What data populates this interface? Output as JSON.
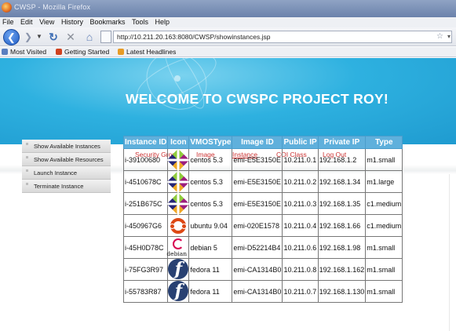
{
  "window": {
    "title": "CWSP - Mozilla Firefox"
  },
  "menu": [
    "File",
    "Edit",
    "View",
    "History",
    "Bookmarks",
    "Tools",
    "Help"
  ],
  "url": "http://10.211.20.163:8080/CWSP/showinstances.jsp",
  "bookmarks": [
    {
      "label": "Most Visited",
      "color": "#5a7fc0"
    },
    {
      "label": "Getting Started",
      "color": "#d0421f"
    },
    {
      "label": "Latest Headlines",
      "color": "#e79b26"
    }
  ],
  "banner": {
    "title": "WELCOME TO CWSPC PROJECT ROY!"
  },
  "nav": [
    {
      "label": "Security Group",
      "active": false
    },
    {
      "label": "Image",
      "active": false
    },
    {
      "label": "Instance",
      "active": true
    },
    {
      "label": "COI Class",
      "active": false
    },
    {
      "label": "Log Out",
      "active": false
    }
  ],
  "sidebar": [
    "Show Available Instances",
    "Show Available Resources",
    "Launch Instance",
    "Terminate Instance"
  ],
  "table": {
    "headers": [
      "Instance ID",
      "Icon",
      "VMOSType",
      "Image ID",
      "Public IP",
      "Private IP",
      "Type"
    ],
    "rows": [
      {
        "id": "i-39100680",
        "icon": "centos-icon",
        "os": "centos 5.3",
        "image": "emi-E5E3150E",
        "public_ip": "10.211.0.1",
        "private_ip": "192.168.1.2",
        "type": "m1.small"
      },
      {
        "id": "i-4510678C",
        "icon": "centos-icon",
        "os": "centos 5.3",
        "image": "emi-E5E3150E",
        "public_ip": "10.211.0.2",
        "private_ip": "192.168.1.34",
        "type": "m1.large"
      },
      {
        "id": "i-251B675C",
        "icon": "centos-icon",
        "os": "centos 5.3",
        "image": "emi-E5E3150E",
        "public_ip": "10.211.0.3",
        "private_ip": "192.168.1.35",
        "type": "c1.medium"
      },
      {
        "id": "i-450967G6",
        "icon": "ubuntu-icon",
        "os": "ubuntu 9.04",
        "image": "emi-020E1578",
        "public_ip": "10.211.0.4",
        "private_ip": "192.168.1.66",
        "type": "c1.medium"
      },
      {
        "id": "i-45H0D78C",
        "icon": "debian-icon",
        "os": "debian 5",
        "image": "emi-D52214B4",
        "public_ip": "10.211.0.6",
        "private_ip": "192.168.1.98",
        "type": "m1.small"
      },
      {
        "id": "i-75FG3R97",
        "icon": "fedora-icon",
        "os": "fedora 11",
        "image": "emi-CA1314B0",
        "public_ip": "10.211.0.8",
        "private_ip": "192.168.1.162",
        "type": "m1.small"
      },
      {
        "id": "i-55783R87",
        "icon": "fedora-icon",
        "os": "fedora 11",
        "image": "emi-CA1314B0",
        "public_ip": "10.211.0.7",
        "private_ip": "192.168.1.130",
        "type": "m1.small"
      }
    ]
  },
  "icon_labels": {
    "debian": "debian"
  }
}
